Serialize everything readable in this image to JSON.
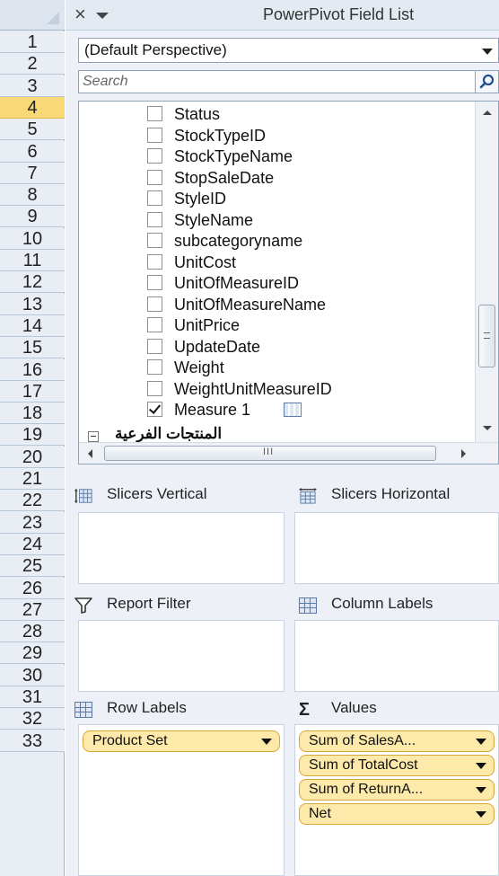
{
  "row_headers": [
    "1",
    "2",
    "3",
    "4",
    "5",
    "6",
    "7",
    "8",
    "9",
    "10",
    "11",
    "12",
    "13",
    "14",
    "15",
    "16",
    "17",
    "18",
    "19",
    "20",
    "21",
    "22",
    "23",
    "24",
    "25",
    "26",
    "27",
    "28",
    "29",
    "30",
    "31",
    "32",
    "33"
  ],
  "selected_row": "4",
  "pane": {
    "title": "PowerPivot Field List",
    "close_glyph": "×",
    "perspective": "(Default Perspective)",
    "search_placeholder": "Search"
  },
  "fields": [
    {
      "label": "Status",
      "checked": false
    },
    {
      "label": "StockTypeID",
      "checked": false
    },
    {
      "label": "StockTypeName",
      "checked": false
    },
    {
      "label": "StopSaleDate",
      "checked": false
    },
    {
      "label": "StyleID",
      "checked": false
    },
    {
      "label": "StyleName",
      "checked": false
    },
    {
      "label": "subcategoryname",
      "checked": false
    },
    {
      "label": "UnitCost",
      "checked": false
    },
    {
      "label": "UnitOfMeasureID",
      "checked": false
    },
    {
      "label": "UnitOfMeasureName",
      "checked": false
    },
    {
      "label": "UnitPrice",
      "checked": false
    },
    {
      "label": "UpdateDate",
      "checked": false
    },
    {
      "label": "Weight",
      "checked": false
    },
    {
      "label": "WeightUnitMeasureID",
      "checked": false
    },
    {
      "label": "Measure 1",
      "checked": true,
      "calc_icon": "calculated-measure-icon"
    }
  ],
  "table_row": {
    "label": "المنتجات الفرعية"
  },
  "hscroll_grip": "III",
  "areas": {
    "slicers_vertical": {
      "label": "Slicers Vertical",
      "icon": "slicer-vertical-icon"
    },
    "slicers_horizontal": {
      "label": "Slicers Horizontal",
      "icon": "slicer-horizontal-icon"
    },
    "report_filter": {
      "label": "Report Filter",
      "icon": "filter-icon"
    },
    "column_labels": {
      "label": "Column Labels",
      "icon": "column-labels-icon"
    },
    "row_labels": {
      "label": "Row Labels",
      "icon": "row-labels-icon",
      "items": [
        "Product Set"
      ]
    },
    "values": {
      "label": "Values",
      "icon": "sigma-icon",
      "symbol": "Σ",
      "items": [
        "Sum of SalesA...",
        "Sum of TotalCost",
        "Sum of ReturnA...",
        "Net"
      ]
    }
  },
  "colors": {
    "selected_row": "#f9d977",
    "pill_fill": "#fde9a9",
    "pill_border": "#d8a73a"
  }
}
